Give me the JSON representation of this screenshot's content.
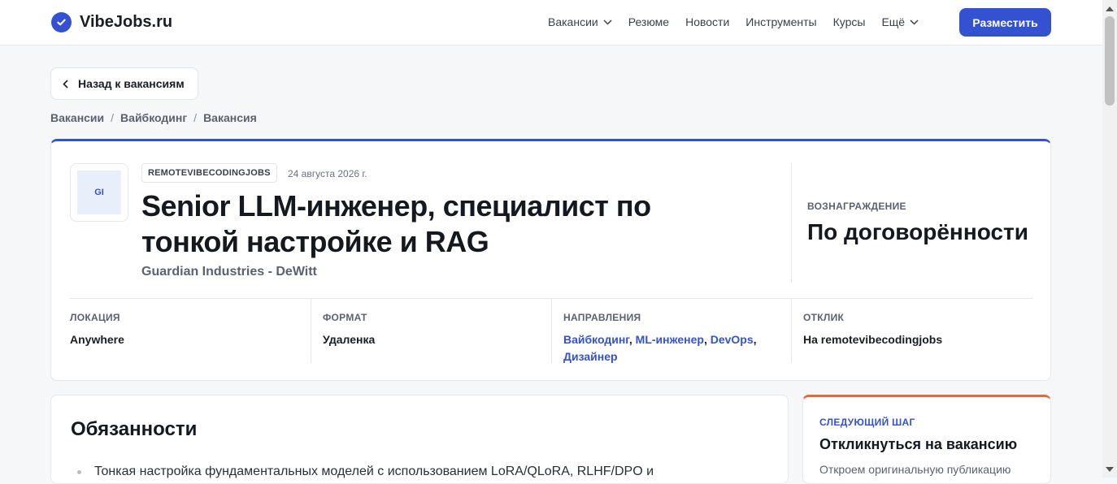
{
  "site": {
    "brand": "VibeJobs.ru"
  },
  "nav": {
    "items": [
      "Вакансии",
      "Резюме",
      "Новости",
      "Инструменты",
      "Курсы",
      "Ещё"
    ],
    "post_button": "Разместить"
  },
  "back_button": "Назад к вакансиям",
  "breadcrumb": [
    "Вакансии",
    "Вайбкодинг",
    "Вакансия"
  ],
  "job": {
    "logo_text": "GI",
    "source": "REMOTEVIBECODINGJOBS",
    "date": "24 августа 2026 г.",
    "title": "Senior LLM-инженер, специалист по тонкой настройке и RAG",
    "company": "Guardian Industries - DeWitt",
    "salary_label": "ВОЗНАГРАЖДЕНИЕ",
    "salary_value": "По договорённости",
    "meta": {
      "location": {
        "label": "ЛОКАЦИЯ",
        "value": "Anywhere"
      },
      "format": {
        "label": "ФОРМАТ",
        "value": "Удаленка"
      },
      "directions": {
        "label": "НАПРАВЛЕНИЯ",
        "values": [
          "Вайбкодинг",
          "ML-инженер",
          "DevOps",
          "Дизайнер"
        ]
      },
      "apply": {
        "label": "ОТКЛИК",
        "value": "На remotevibecodingjobs"
      }
    }
  },
  "duties": {
    "title": "Обязанности",
    "items": [
      "Тонкая настройка фундаментальных моделей с использованием LoRA/QLoRA, RLHF/DPO и"
    ]
  },
  "next_step": {
    "label": "СЛЕДУЮЩИЙ ШАГ",
    "title": "Откликнуться на вакансию",
    "description": "Откроем оригинальную публикацию"
  },
  "colors": {
    "accent": "#3451d1",
    "next_step_accent": "#e8663d"
  }
}
